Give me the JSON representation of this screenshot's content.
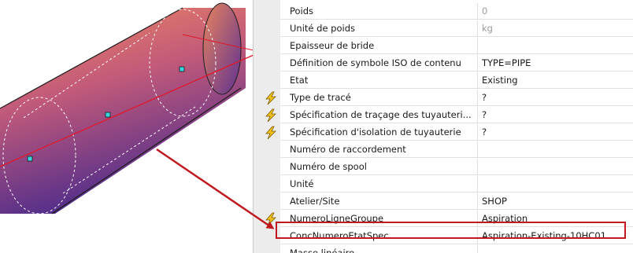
{
  "viewport": {
    "label": "3D pipe viewport"
  },
  "properties": {
    "rows": [
      {
        "name": "Poids",
        "value": "0",
        "bolt": false,
        "dim": true
      },
      {
        "name": "Unité de poids",
        "value": "kg",
        "bolt": false,
        "dim": true
      },
      {
        "name": "Epaisseur de bride",
        "value": "",
        "bolt": false,
        "dim": false
      },
      {
        "name": "Définition de symbole ISO de contenu",
        "value": "TYPE=PIPE",
        "bolt": false,
        "dim": false
      },
      {
        "name": "Etat",
        "value": "Existing",
        "bolt": false,
        "dim": false
      },
      {
        "name": "Type de tracé",
        "value": "?",
        "bolt": true,
        "dim": false
      },
      {
        "name": "Spécification de traçage des tuyauteri...",
        "value": "?",
        "bolt": true,
        "dim": false
      },
      {
        "name": "Spécification d'isolation de tuyauterie",
        "value": "?",
        "bolt": true,
        "dim": false
      },
      {
        "name": "Numéro de raccordement",
        "value": "",
        "bolt": false,
        "dim": false
      },
      {
        "name": "Numéro de spool",
        "value": "",
        "bolt": false,
        "dim": false
      },
      {
        "name": "Unité",
        "value": "",
        "bolt": false,
        "dim": false
      },
      {
        "name": "Atelier/Site",
        "value": "SHOP",
        "bolt": false,
        "dim": false
      },
      {
        "name": "NumeroLigneGroupe",
        "value": "Aspiration",
        "bolt": true,
        "dim": false
      },
      {
        "name": "ConcNumeroEtatSpec",
        "value": "Aspiration-Existing-10HC01",
        "bolt": false,
        "dim": false
      },
      {
        "name": "Masse linéaire",
        "value": "",
        "bolt": false,
        "dim": false
      }
    ]
  },
  "colors": {
    "highlight": "#c0191f",
    "bolt_fill": "#f2c21b",
    "bolt_stroke": "#7a5a00",
    "pipe_light": "#e9866a",
    "pipe_dark": "#5a2f8f"
  }
}
